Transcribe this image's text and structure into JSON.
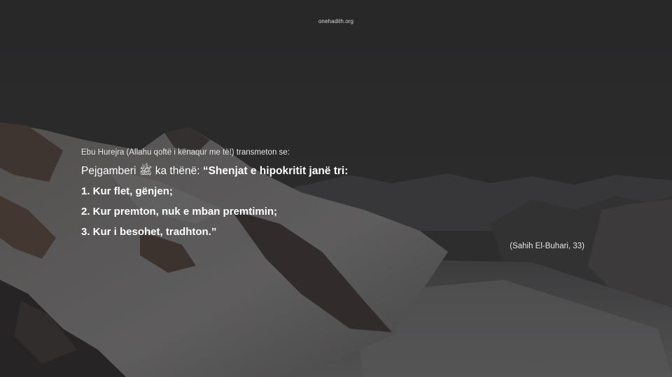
{
  "site": {
    "name": "onehadith.org"
  },
  "hadith": {
    "narrator": "Ebu Hurejra (Allahu qoftë i kënaqur me të!) transmeton se:",
    "intro_prefix": "Pejgamberi ﷺ ka thënë: ",
    "intro_quote": "“Shenjat e hipokritit janë tri:",
    "lines": [
      "1. Kur flet, gënjen;",
      "2. Kur premton, nuk e mban premtimin;",
      "3. Kur i besohet, tradhton.”"
    ],
    "source": "(Sahih El-Buhari, 33)"
  },
  "colors": {
    "background_overlay": "#2f2f30",
    "text": "#ffffff",
    "snow": "#8a8a8c",
    "rock": "#4a3a33"
  }
}
